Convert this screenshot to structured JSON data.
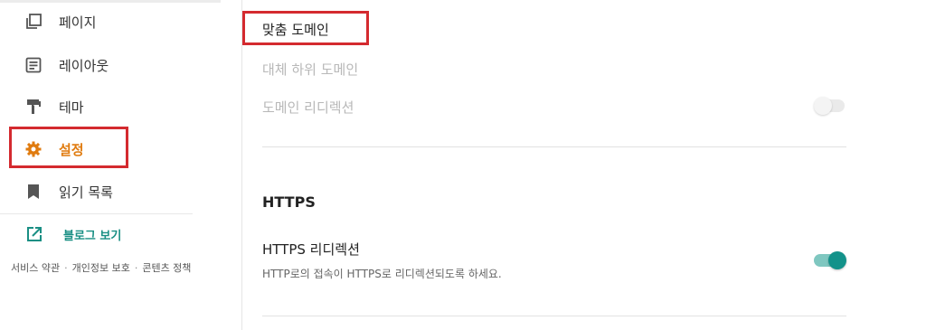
{
  "sidebar": {
    "items": [
      {
        "label": "페이지",
        "icon": "pages-icon"
      },
      {
        "label": "레이아웃",
        "icon": "layout-icon"
      },
      {
        "label": "테마",
        "icon": "paint-roller-icon"
      },
      {
        "label": "설정",
        "icon": "gear-icon",
        "active": true
      },
      {
        "label": "읽기 목록",
        "icon": "bookmark-icon"
      }
    ],
    "view_blog": {
      "label": "블로그 보기",
      "icon": "open-external-icon"
    },
    "footer": {
      "terms": "서비스 약관",
      "privacy": "개인정보 보호",
      "content_policy": "콘텐츠 정책",
      "separator": "·"
    }
  },
  "main": {
    "custom_domain": "맞춤 도메인",
    "alternate_subdomain": "대체 하위 도메인",
    "domain_redirect": {
      "label": "도메인 리디렉션",
      "enabled": false
    },
    "https": {
      "section_title": "HTTPS",
      "redirect_label": "HTTPS 리디렉션",
      "redirect_desc": "HTTP로의 접속이 HTTPS로 리디렉션되도록 하세요.",
      "redirect_enabled": true
    }
  },
  "colors": {
    "accent_orange": "#e07b0f",
    "teal": "#13928a",
    "highlight_red": "#d42a2f"
  }
}
